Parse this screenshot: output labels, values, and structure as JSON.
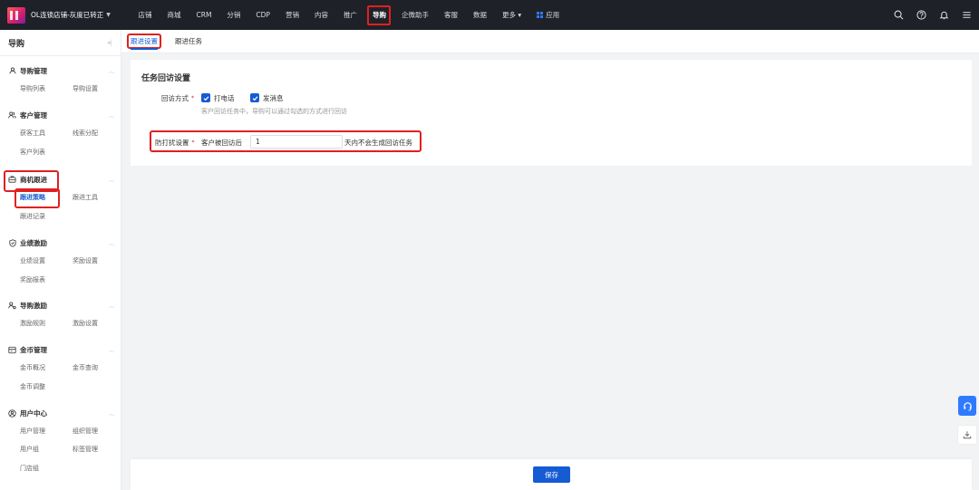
{
  "topbar": {
    "shop_name": "OL连锁店铺-灰度已转正",
    "nav": [
      "店铺",
      "商城",
      "CRM",
      "分销",
      "CDP",
      "营销",
      "内容",
      "推广",
      "导购",
      "企微助手",
      "客服",
      "数据",
      "更多 ▾",
      "应用"
    ],
    "active_nav": "导购"
  },
  "sidebar": {
    "title": "导购",
    "groups": [
      {
        "label": "导购管理",
        "items": [
          "导购列表",
          "导购设置"
        ]
      },
      {
        "label": "客户管理",
        "items": [
          "获客工具",
          "线索分配",
          "客户列表"
        ]
      },
      {
        "label": "商机跟进",
        "items": [
          "跟进策略",
          "跟进工具",
          "跟进记录"
        ]
      },
      {
        "label": "业绩激励",
        "items": [
          "业绩设置",
          "奖励设置",
          "奖励报表"
        ]
      },
      {
        "label": "导购激励",
        "items": [
          "激励规则",
          "激励设置"
        ]
      },
      {
        "label": "金币管理",
        "items": [
          "金币概况",
          "金币查询",
          "金币调整"
        ]
      },
      {
        "label": "用户中心",
        "items": [
          "用户管理",
          "组织管理",
          "用户组",
          "标签管理",
          "门店组"
        ]
      }
    ],
    "active_item": "跟进策略"
  },
  "tabs": [
    "跟进设置",
    "跟进任务"
  ],
  "active_tab": "跟进设置",
  "card": {
    "title": "任务回访设置",
    "visit_method_label": "回访方式",
    "required_mark": "*",
    "options": [
      "打电话",
      "发消息"
    ],
    "options_checked": [
      true,
      true
    ],
    "hint": "客户回访任务中，导购可以通过勾选的方式进行回访",
    "dnd_label": "防打扰设置",
    "dnd_prefix": "客户被回访后",
    "dnd_value": "1",
    "dnd_suffix": "天内不会生成回访任务"
  },
  "footer": {
    "save_label": "保存"
  },
  "colors": {
    "primary": "#155bd4",
    "highlight": "#e02020",
    "topbar": "#1f2129"
  }
}
